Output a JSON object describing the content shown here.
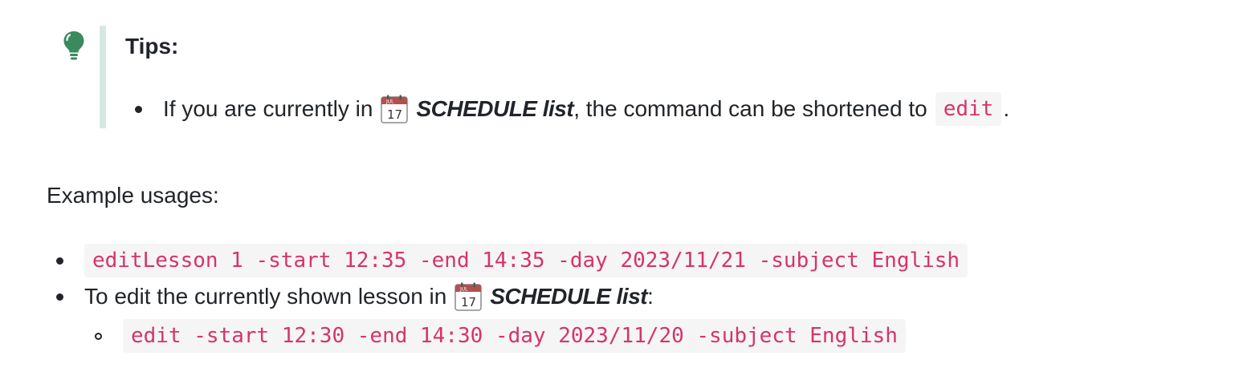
{
  "tip": {
    "title": "Tips:",
    "icon": "lightbulb-icon",
    "accent_color": "#3a8a5f",
    "bar_color": "#d6e9e1",
    "item": {
      "text_before": "If you are currently in",
      "emoji": "calendar-icon",
      "emphasis": "SCHEDULE list",
      "text_after": ", the command can be shortened to",
      "code": "edit",
      "end": "."
    }
  },
  "example": {
    "label": "Example usages:",
    "items": [
      {
        "code": "editLesson 1 -start 12:35 -end 14:35 -day 2023/11/21 -subject English"
      },
      {
        "text_before": "To edit the currently shown lesson in",
        "emoji": "calendar-icon",
        "emphasis": "SCHEDULE list",
        "text_after": ":",
        "subitems": [
          {
            "code": "edit -start 12:30 -end 14:30 -day 2023/11/20 -subject English"
          }
        ]
      }
    ]
  },
  "colors": {
    "code_text": "#d6336c",
    "code_bg": "#f5f5f5",
    "body_text": "#212529"
  }
}
